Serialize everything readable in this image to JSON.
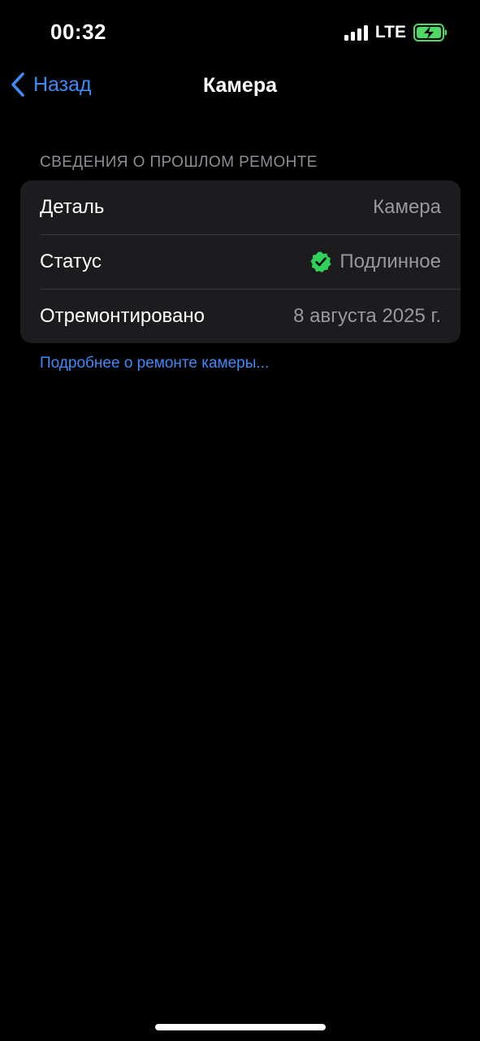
{
  "status_bar": {
    "time": "00:32",
    "network": "LTE",
    "signal_bars": 4,
    "battery_charging": true,
    "battery_color": "#4cd964"
  },
  "nav": {
    "back_label": "Назад",
    "back_icon": "chevron-left-icon",
    "title": "Камера"
  },
  "section": {
    "header": "СВЕДЕНИЯ О ПРОШЛОМ РЕМОНТЕ",
    "rows": [
      {
        "label": "Деталь",
        "value": "Камера"
      },
      {
        "label": "Статус",
        "value": "Подлинное",
        "icon": "verified-badge-icon",
        "icon_color": "#30d158"
      },
      {
        "label": "Отремонтировано",
        "value": "8 августа 2025 г."
      }
    ]
  },
  "link": "Подробнее о ремонте камеры...",
  "colors": {
    "accent": "#3d8af7",
    "background": "#000000",
    "card": "#1c1c1e"
  }
}
